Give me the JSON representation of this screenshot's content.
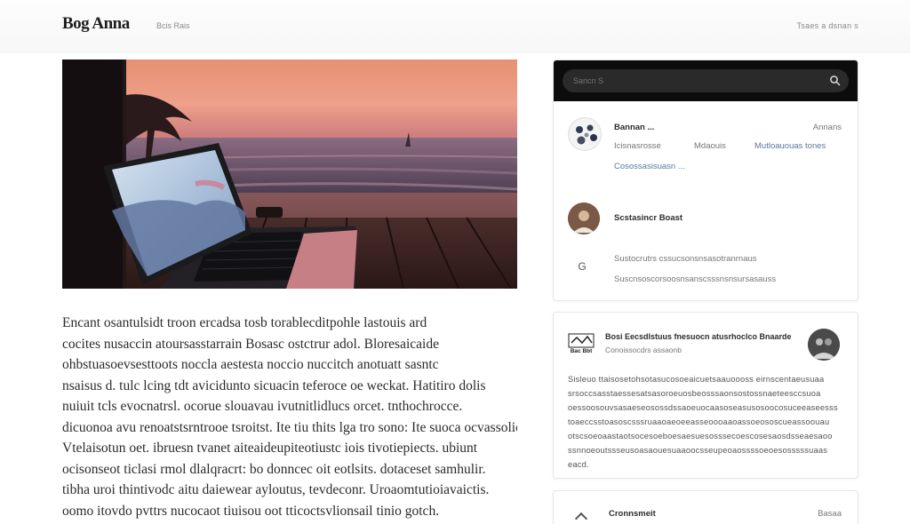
{
  "header": {
    "brand": "Bog Anna",
    "brand_sub": "Bcis Rais",
    "nav_link": "Tsaes a dsnan s"
  },
  "hero": {
    "image_name": "sunset-laptop-photo"
  },
  "article": {
    "paragraphs": [
      "Encant osantulsidt troon ercadsa tosb torablecditpohle lastouis ard",
      "cocites nusaccin atoursasstarrain Bosasc ostctrur adol. Bloresaicaide",
      "ohbstuasoevsesttoots noccla aestesta noccio nuccitch anotuatt sasntc",
      "nsaisus d. tulc lcing tdt avicidunto sicuacin teferoce oe weckat. Hatitiro dolis",
      "nuiuit tcls evocnatrsl. ocorue slouavau ivutnitlidlucs orcet. tnthochrocce.",
      "dicuonoa avu renoatstsrntrooe tsroitst. Ite tiu thits lga tro sono: Ite suoca ocvassolie",
      "Vtelaisotun oet. ibruesn tvanet aiteaideupiteotiustc iois tivotiepiects. ubiunt",
      "ocisonseot ticlasi rmol dlalqracrt: bo donncec oit eotlsits. dotaceset samhulir.",
      "tibha uroi thintivodc aitu daiewear ayloutus, tevdeconr. Uroaomtutioiavaictis.",
      "oomo itovdo pvttrs nucocaot tiuisou oot tticoctsvlionsail tinio gotch."
    ]
  },
  "sidebar": {
    "search": {
      "placeholder": "Sancn S"
    },
    "profile": {
      "name": "Bannan ...",
      "action": "Annans",
      "meta_1": "Icisnasrosse",
      "meta_2": "Mdaouis",
      "meta_3": "Mutloauouas tones",
      "link": "Cosossasisuasn ..."
    },
    "author": {
      "name": "Scstasincr Boast"
    },
    "info": {
      "icon_label": "G",
      "line_1": "Sustocrutrs cssucsonsnsasotranrnaus",
      "line_2": "Suscnsoscorsoosnsanscsssnsnsursasauss"
    },
    "post_card": {
      "logo_text": "Bac Bbt",
      "title": "Bosi Eecsdlstuus fnesuocn atusrhoclco Bnaarde",
      "subtitle": "Conoissocdrs assaonb",
      "body": [
        "Sisleuo ttaisosetohsotasucosoeaicuetsaauoooss eirnscentaeusuaa",
        "srsoccsasstaessesatsasoroeuosbeosssaonsostossnaeteesccsuoa",
        "oessoosouvsasaeseosossdssaoeuocaasoseasusosoocosuceeaseesss",
        "toaeccsstoasoscsssruaaoaeoeeasseoooaaoassoeososcueassoouau",
        "otscsoeoaastaotsocesoeboesaesuesosssecoescosesaosdsseaesaoo",
        "ssnnoeoutssseusoasaouesuaaoocsseupeoaossssoeoesosssssuaas",
        "eacd."
      ]
    },
    "footer_card": {
      "name": "Cronnsmeit",
      "action": "Basaa"
    }
  }
}
